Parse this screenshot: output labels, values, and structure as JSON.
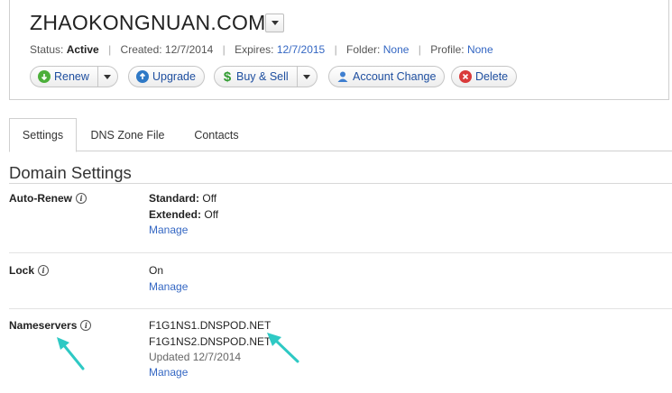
{
  "header": {
    "domain": "ZHAOKONGNUAN.COM",
    "status_label": "Status:",
    "status_value": "Active",
    "created_label": "Created:",
    "created_value": "12/7/2014",
    "expires_label": "Expires:",
    "expires_value": "12/7/2015",
    "folder_label": "Folder:",
    "folder_value": "None",
    "profile_label": "Profile:",
    "profile_value": "None",
    "separator": "|"
  },
  "actions": {
    "renew": "Renew",
    "upgrade": "Upgrade",
    "buy_sell": "Buy & Sell",
    "account_change": "Account Change",
    "delete": "Delete"
  },
  "tabs": [
    {
      "label": "Settings",
      "active": true
    },
    {
      "label": "DNS Zone File",
      "active": false
    },
    {
      "label": "Contacts",
      "active": false
    }
  ],
  "settings": {
    "title": "Domain Settings",
    "auto_renew": {
      "label": "Auto-Renew",
      "standard_label": "Standard:",
      "standard_value": "Off",
      "extended_label": "Extended:",
      "extended_value": "Off",
      "manage": "Manage"
    },
    "lock": {
      "label": "Lock",
      "value": "On",
      "manage": "Manage"
    },
    "nameservers": {
      "label": "Nameservers",
      "ns1": "F1G1NS1.DNSPOD.NET",
      "ns2": "F1G1NS2.DNSPOD.NET",
      "updated": "Updated 12/7/2014",
      "manage": "Manage"
    }
  },
  "colors": {
    "link": "#3467c3",
    "annotation_arrow": "#2ec9c4",
    "renew_icon": "#4caf3a",
    "upgrade_icon": "#2f79c6",
    "buy_sell_icon": "#2e9a2e",
    "delete_icon": "#d93a3a"
  }
}
